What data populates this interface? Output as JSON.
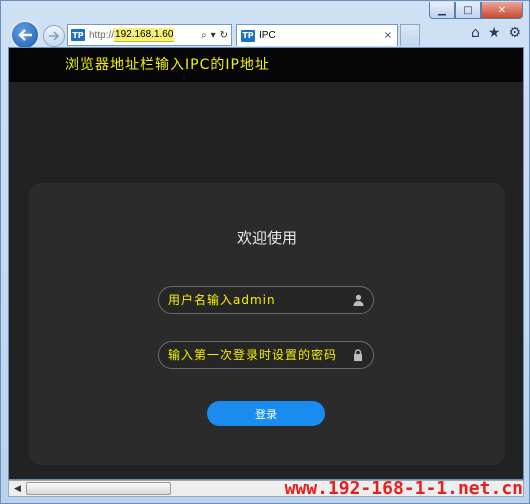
{
  "browser": {
    "url_scheme": "http://",
    "url_host": "192.168.1.60",
    "address_icons": [
      "search-icon",
      "dropdown-icon",
      "refresh-icon"
    ],
    "tab_title": "IPC",
    "tab_favicon": "TP",
    "address_favicon": "TP",
    "tab_close": "×",
    "right_icons": [
      "home-icon",
      "favorites-star-icon",
      "settings-gear-icon"
    ]
  },
  "annotations": {
    "address_note": "浏览器地址栏输入IPC的IP地址"
  },
  "login": {
    "welcome": "欢迎使用",
    "username_placeholder": "用户名输入admin",
    "password_placeholder": "输入第一次登录时设置的密码",
    "login_button": "登录"
  },
  "watermark": "www.192-168-1-1.net.cn",
  "colors": {
    "page_bg": "#222222",
    "card_bg": "#2b2b2b",
    "accent": "#1a8cf0",
    "note_yellow": "#f5f000",
    "watermark_red": "#e81f1f"
  }
}
